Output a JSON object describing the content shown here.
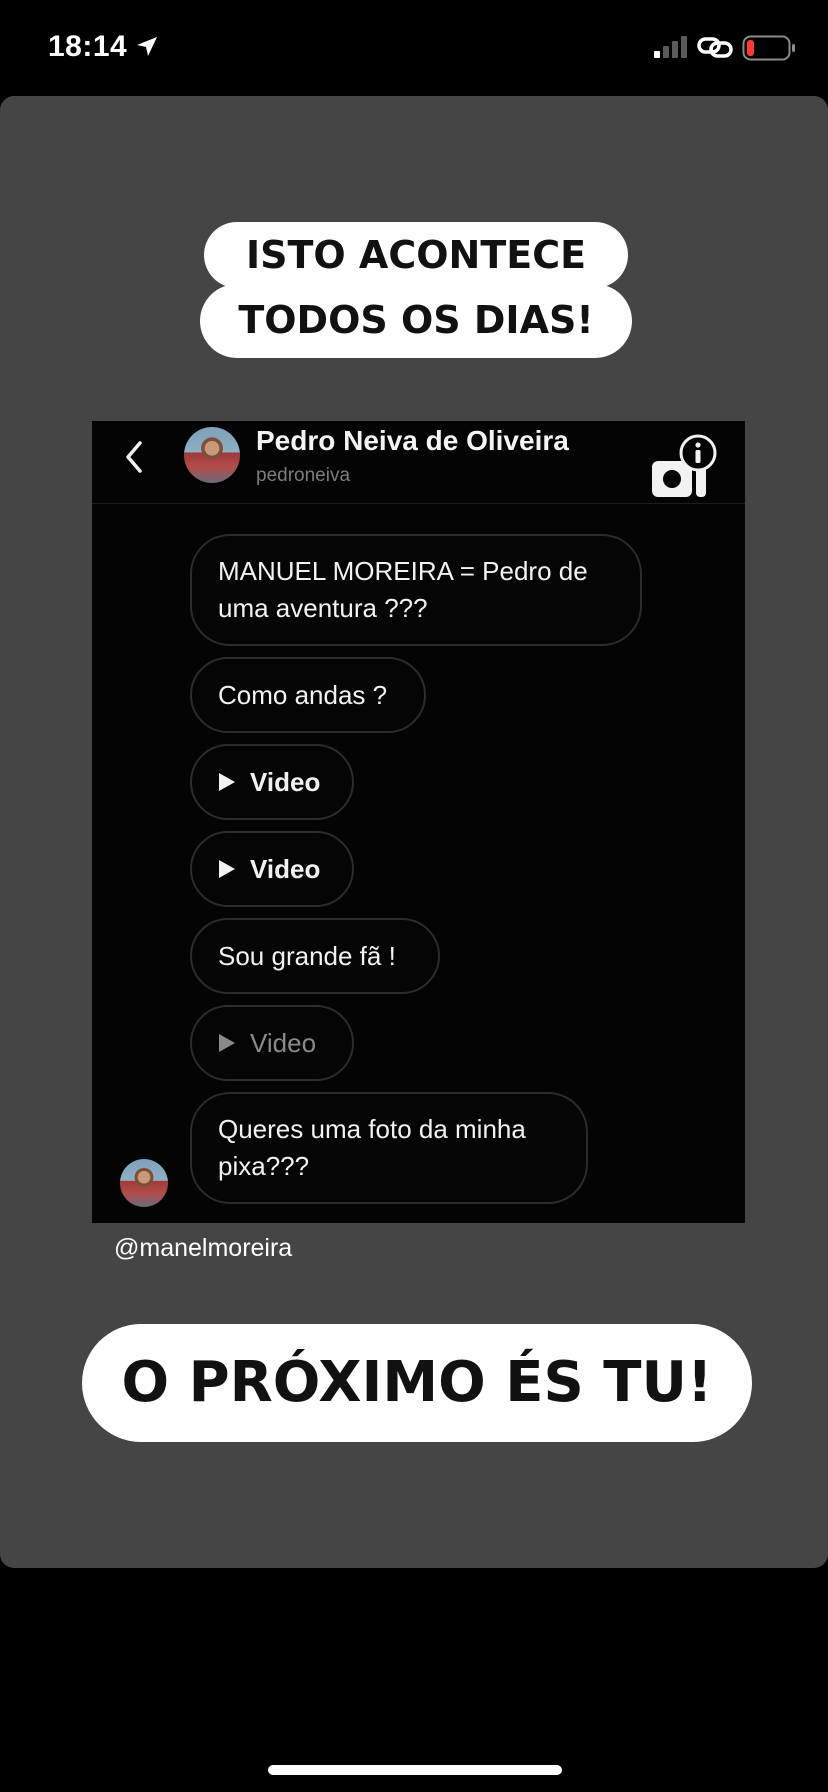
{
  "status_bar": {
    "time": "18:14",
    "icons": [
      "location-arrow-icon",
      "signal-icon",
      "link-icon",
      "battery-icon"
    ],
    "battery_color": "#ff3b30"
  },
  "story": {
    "background_color": "#454545",
    "headline_line1": "ISTO ACONTECE",
    "headline_line2": "TODOS OS DIAS!",
    "username_tag": "@manelmoreira",
    "cta": "O PRÓXIMO ÉS TU!"
  },
  "dm": {
    "contact_name": "Pedro Neiva de Oliveira",
    "contact_handle": "pedroneiva",
    "header_icons": [
      "back-chevron-icon",
      "video-call-icon",
      "info-icon"
    ],
    "messages": [
      {
        "type": "text",
        "text": "MANUEL MOREIRA = Pedro de uma aventura ???"
      },
      {
        "type": "text",
        "text": "Como andas ?"
      },
      {
        "type": "video",
        "label": "Video"
      },
      {
        "type": "video",
        "label": "Video"
      },
      {
        "type": "text",
        "text": "Sou grande fã !"
      },
      {
        "type": "video",
        "label": "Video"
      },
      {
        "type": "text",
        "text": "Queres uma foto da minha pixa???"
      }
    ]
  }
}
